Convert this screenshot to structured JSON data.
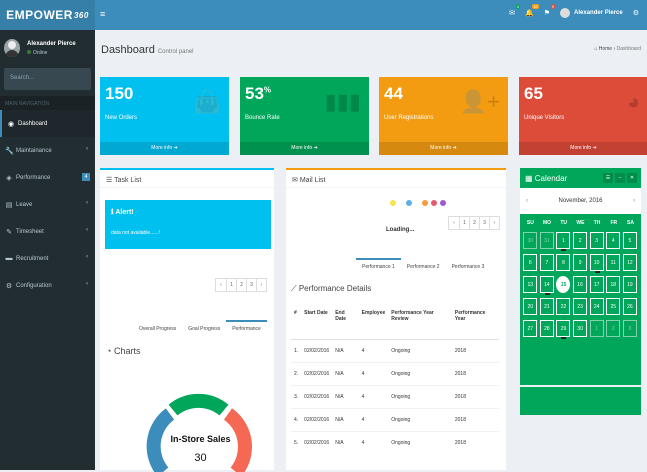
{
  "app": {
    "logo": "EMPOWER",
    "logo_suffix": "360"
  },
  "user": {
    "name": "Alexander Pierce",
    "status": "Online"
  },
  "sidebar": {
    "search_placeholder": "Search...",
    "header": "MAIN NAVIGATION",
    "items": [
      {
        "label": "Dashboard",
        "icon": "dashboard-icon",
        "active": true
      },
      {
        "label": "Maintainance",
        "icon": "wrench-icon"
      },
      {
        "label": "Performance",
        "icon": "performance-icon",
        "badge": "4"
      },
      {
        "label": "Leave",
        "icon": "leave-icon"
      },
      {
        "label": "Timesheet",
        "icon": "pencil-icon"
      },
      {
        "label": "Recruitment",
        "icon": "truck-icon"
      },
      {
        "label": "Configuration",
        "icon": "gear-icon"
      }
    ]
  },
  "topbar": {
    "messages_badge": "4",
    "notifications_badge": "10",
    "tasks_badge": "9",
    "user_name": "Alexander Pierce"
  },
  "page": {
    "title": "Dashboard",
    "subtitle": "Control panel",
    "crumb_home": "Home",
    "crumb_current": "Dashboard"
  },
  "boxes": [
    {
      "value": "150",
      "sup": "",
      "label": "New Orders",
      "more": "More info",
      "color": "#00c0ef",
      "icon": "bag-icon"
    },
    {
      "value": "53",
      "sup": "%",
      "label": "Bounce Rate",
      "more": "More info",
      "color": "#00a65a",
      "icon": "bar-chart-icon"
    },
    {
      "value": "44",
      "sup": "",
      "label": "User Registrations",
      "more": "More info",
      "color": "#f39c12",
      "icon": "user-plus-icon"
    },
    {
      "value": "65",
      "sup": "",
      "label": "Unique Visitors",
      "more": "More info",
      "color": "#dd4b39",
      "icon": "pie-chart-icon"
    }
  ],
  "task_list": {
    "title": "Task List",
    "alert_title": "Alert!",
    "alert_msg": "data not available......!",
    "pages": [
      "‹",
      "1",
      "2",
      "3",
      "›"
    ]
  },
  "mail_list": {
    "title": "Mail List",
    "loading": "Loading...",
    "dot_colors": [
      "#f7e54c",
      "#5ab0ea",
      "#f59b3a",
      "#e45a6e",
      "#a05ad1"
    ],
    "pages": [
      "‹",
      "1",
      "2",
      "3",
      "›"
    ]
  },
  "charts": {
    "tabs": [
      "Overall Progress",
      "Goal Progress",
      "Performance"
    ],
    "title": "Charts",
    "center_label": "In-Store Sales",
    "center_value": "30"
  },
  "performance": {
    "tabs": [
      "Performance 1",
      "Performance 2",
      "Performance 3"
    ],
    "title": "Performance Details",
    "headers": [
      "#",
      "Start Date",
      "End Date",
      "Employee",
      "Performance Year Review",
      "Performance Year"
    ],
    "rows": [
      [
        "1.",
        "02/02/2016",
        "N/A",
        "4",
        "Ongoing",
        "2018"
      ],
      [
        "2.",
        "02/02/2016",
        "N/A",
        "4",
        "Ongoing",
        "2018"
      ],
      [
        "3.",
        "02/02/2016",
        "N/A",
        "4",
        "Ongoing",
        "2018"
      ],
      [
        "4.",
        "02/02/2016",
        "N/A",
        "4",
        "Ongoing",
        "2018"
      ],
      [
        "5.",
        "02/02/2016",
        "N/A",
        "4",
        "Ongoing",
        "2018"
      ]
    ]
  },
  "calendar": {
    "title": "Calendar",
    "month": "November, 2016",
    "weekdays": [
      "SU",
      "MO",
      "TU",
      "WE",
      "TH",
      "FR",
      "SA"
    ],
    "weeks": [
      [
        "30",
        "31",
        "1",
        "2",
        "3",
        "4",
        "5"
      ],
      [
        "6",
        "7",
        "8",
        "9",
        "10",
        "11",
        "12"
      ],
      [
        "13",
        "14",
        "15",
        "16",
        "17",
        "18",
        "19"
      ],
      [
        "20",
        "21",
        "22",
        "23",
        "24",
        "25",
        "26"
      ],
      [
        "27",
        "28",
        "29",
        "30",
        "1",
        "2",
        "3"
      ]
    ],
    "today": "15"
  }
}
